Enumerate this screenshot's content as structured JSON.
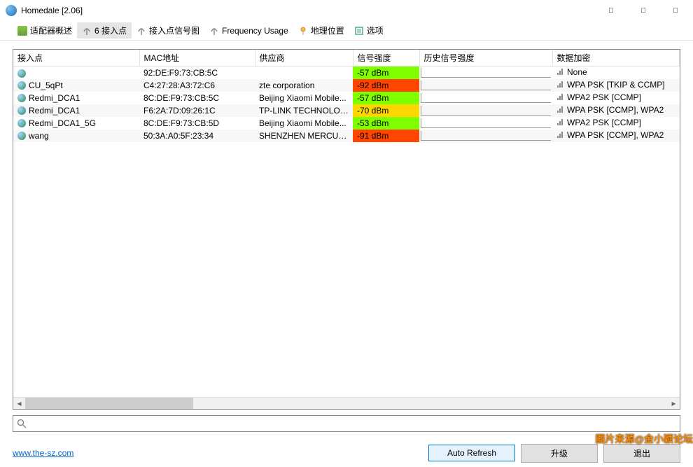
{
  "window": {
    "title": "Homedale [2.06]"
  },
  "toolbar": {
    "adapter": "适配器概述",
    "ap": "6 接入点",
    "sigmap": "接入点信号图",
    "freq": "Frequency Usage",
    "geo": "地理位置",
    "options": "选项"
  },
  "columns": {
    "ap": "接入点",
    "mac": "MAC地址",
    "vendor": "供应商",
    "signal": "信号强度",
    "history": "历史信号强度",
    "encryption": "数据加密"
  },
  "rows": [
    {
      "ap": "",
      "mac": "92:DE:F9:73:CB:5C",
      "vendor": "",
      "signal": "-57 dBm",
      "sigclass": "sig-green",
      "enc": "None"
    },
    {
      "ap": "CU_5qPt",
      "mac": "C4:27:28:A3:72:C6",
      "vendor": "zte corporation",
      "signal": "-92 dBm",
      "sigclass": "sig-red",
      "enc": "WPA PSK [TKIP & CCMP]"
    },
    {
      "ap": "Redmi_DCA1",
      "mac": "8C:DE:F9:73:CB:5C",
      "vendor": "Beijing Xiaomi Mobile...",
      "signal": "-57 dBm",
      "sigclass": "sig-green",
      "enc": "WPA2 PSK [CCMP]"
    },
    {
      "ap": "Redmi_DCA1",
      "mac": "F6:2A:7D:09:26:1C",
      "vendor": "TP-LINK TECHNOLOGI...",
      "signal": "-70 dBm",
      "sigclass": "sig-yellow",
      "enc": "WPA PSK [CCMP], WPA2"
    },
    {
      "ap": "Redmi_DCA1_5G",
      "mac": "8C:DE:F9:73:CB:5D",
      "vendor": "Beijing Xiaomi Mobile...",
      "signal": "-53 dBm",
      "sigclass": "sig-green",
      "enc": "WPA2 PSK [CCMP]"
    },
    {
      "ap": "wang",
      "mac": "50:3A:A0:5F:23:34",
      "vendor": "SHENZHEN MERCURY...",
      "signal": "-91 dBm",
      "sigclass": "sig-red",
      "enc": "WPA PSK [CCMP], WPA2"
    }
  ],
  "footer": {
    "link": "www.the-sz.com",
    "autorefresh": "Auto Refresh",
    "upgrade": "升级",
    "exit": "退出"
  },
  "search": {
    "placeholder": ""
  },
  "watermark": "图片来源@金小颖论坛"
}
